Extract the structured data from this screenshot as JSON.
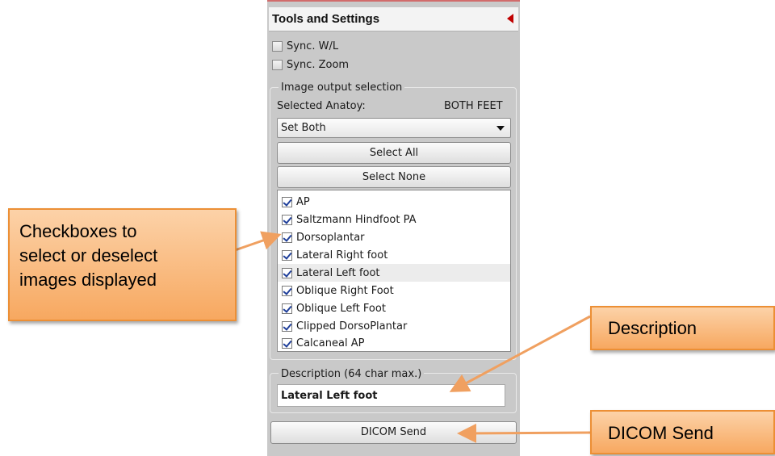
{
  "panel": {
    "title": "Tools and Settings",
    "sync_wl_label": "Sync. W/L",
    "sync_zoom_label": "Sync. Zoom",
    "output_group_label": "Image output selection",
    "selected_anatomy_label": "Selected Anatoy:",
    "selected_anatomy_value": "BOTH FEET",
    "set_select_value": "Set Both",
    "select_all_label": "Select All",
    "select_none_label": "Select None",
    "images": [
      {
        "label": "AP",
        "checked": true
      },
      {
        "label": "Saltzmann Hindfoot PA",
        "checked": true
      },
      {
        "label": "Dorsoplantar",
        "checked": true
      },
      {
        "label": "Lateral Right foot",
        "checked": true
      },
      {
        "label": "Lateral Left foot",
        "checked": true
      },
      {
        "label": "Oblique Right Foot",
        "checked": true
      },
      {
        "label": "Oblique Left Foot",
        "checked": true
      },
      {
        "label": "Clipped DorsoPlantar",
        "checked": true
      },
      {
        "label": "Calcaneal AP",
        "checked": true
      }
    ],
    "description_label": "Description (64 char max.)",
    "description_value": "Lateral Left foot",
    "dicom_send_label": "DICOM Send"
  },
  "callouts": {
    "checkboxes": [
      "Checkboxes to",
      "select or deselect",
      "images displayed"
    ],
    "description": "Description",
    "dicom_send": "DICOM Send"
  },
  "colors": {
    "panel_bg": "#c9c9c9",
    "callout_fill": "#f7a860",
    "callout_border": "#ec8f35",
    "collapse_arrow": "#c00000",
    "check_mark": "#1f3f9a"
  },
  "icons": {
    "collapse": "triangle-left-icon",
    "dropdown": "chevron-down-icon",
    "check": "checkmark-icon"
  }
}
